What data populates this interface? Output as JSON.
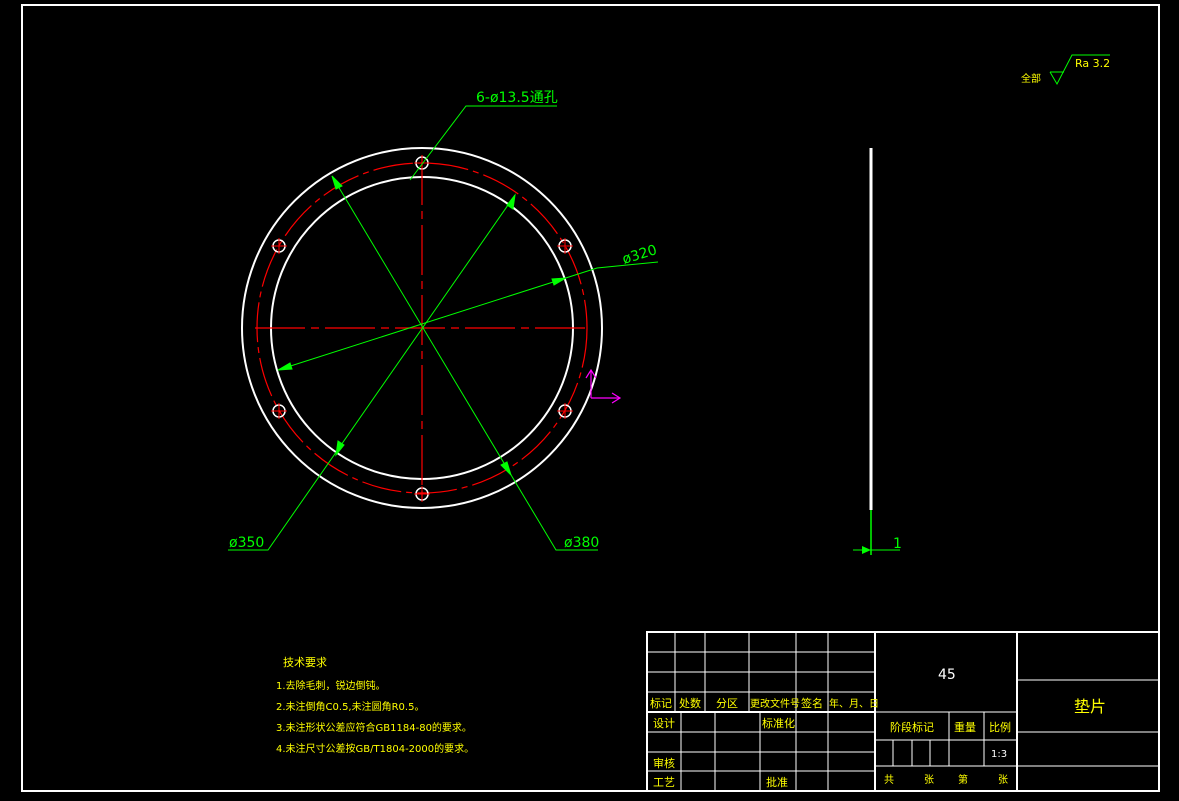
{
  "colors": {
    "background": "#000000",
    "outline": "#ffffff",
    "dimension": "#00ff00",
    "centerline": "#ff0000",
    "annotation_text": "#ffff00",
    "ucs_icon": "#ff00ff"
  },
  "drawing": {
    "hole_label": "6-ø13.5通孔",
    "dia_320": "ø320",
    "dia_350": "ø350",
    "dia_380": "ø380",
    "thickness": "1",
    "roughness_prefix": "全部",
    "roughness_value": "Ra 3.2"
  },
  "tech": {
    "title": "技术要求",
    "items": [
      "1.去除毛刺，锐边倒钝。",
      "2.未注倒角C0.5,未注圆角R0.5。",
      "3.未注形状公差应符合GB1184-80的要求。",
      "4.未注尺寸公差按GB/T1804-2000的要求。"
    ]
  },
  "title_block": {
    "material": "45",
    "part_name": "垫片",
    "col_mark": "标记",
    "col_count": "处数",
    "col_zone": "分区",
    "col_doc": "更改文件号",
    "col_sign": "签名",
    "col_date": "年、月、日",
    "design": "设计",
    "standardize": "标准化",
    "check": "审核",
    "process": "工艺",
    "approve": "批准",
    "stage_mark": "阶段标记",
    "weight": "重量",
    "scale_label": "比例",
    "scale_value": "1:3",
    "total": "共",
    "sheets1": "张",
    "num": "第",
    "sheets2": "张"
  }
}
